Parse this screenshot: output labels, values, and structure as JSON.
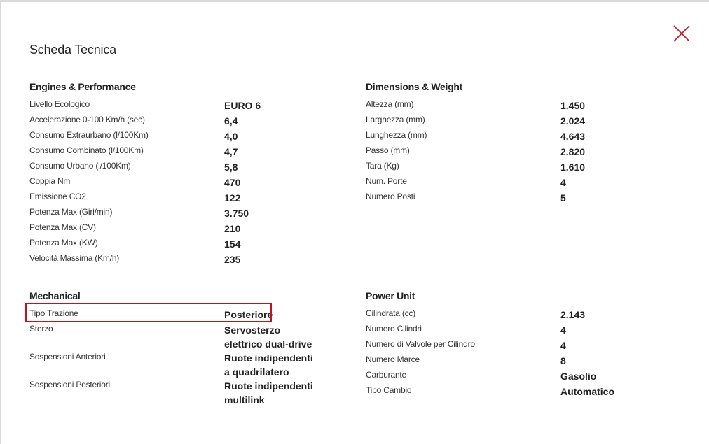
{
  "modal": {
    "title": "Scheda Tecnica",
    "close_icon": "close-icon",
    "accent_color": "#c1121f"
  },
  "sections": {
    "engines": {
      "heading": "Engines & Performance",
      "rows": [
        {
          "label": "Livello Ecologico",
          "value": "EURO 6"
        },
        {
          "label": "Accelerazione 0-100 Km/h (sec)",
          "value": "6,4"
        },
        {
          "label": "Consumo Extraurbano (l/100Km)",
          "value": "4,0"
        },
        {
          "label": "Consumo Combinato (l/100Km)",
          "value": "4,7"
        },
        {
          "label": "Consumo Urbano (l/100Km)",
          "value": "5,8"
        },
        {
          "label": "Coppia Nm",
          "value": "470"
        },
        {
          "label": "Emissione CO2",
          "value": "122"
        },
        {
          "label": "Potenza Max (Giri/min)",
          "value": "3.750"
        },
        {
          "label": "Potenza Max (CV)",
          "value": "210"
        },
        {
          "label": "Potenza Max (KW)",
          "value": "154"
        },
        {
          "label": "Velocità Massima (Km/h)",
          "value": "235"
        }
      ]
    },
    "dimensions": {
      "heading": "Dimensions & Weight",
      "rows": [
        {
          "label": "Altezza (mm)",
          "value": "1.450"
        },
        {
          "label": "Larghezza (mm)",
          "value": "2.024"
        },
        {
          "label": "Lunghezza (mm)",
          "value": "4.643"
        },
        {
          "label": "Passo (mm)",
          "value": "2.820"
        },
        {
          "label": "Tara (Kg)",
          "value": "1.610"
        },
        {
          "label": "Num. Porte",
          "value": "4"
        },
        {
          "label": "Numero Posti",
          "value": "5"
        }
      ]
    },
    "mechanical": {
      "heading": "Mechanical",
      "rows": [
        {
          "label": "Tipo Trazione",
          "value": "Posteriore"
        },
        {
          "label": "Sterzo",
          "value": "Servosterzo elettrico dual-drive"
        },
        {
          "label": "Sospensioni Anteriori",
          "value": "Ruote indipendenti a quadrilatero"
        },
        {
          "label": "Sospensioni Posteriori",
          "value": "Ruote indipendenti multilink"
        }
      ]
    },
    "power_unit": {
      "heading": "Power Unit",
      "rows": [
        {
          "label": "Cilindrata (cc)",
          "value": "2.143"
        },
        {
          "label": "Numero Cilindri",
          "value": "4"
        },
        {
          "label": "Numero di Valvole per Cilindro",
          "value": "4"
        },
        {
          "label": "Numero Marce",
          "value": "8"
        },
        {
          "label": "Carburante",
          "value": "Gasolio"
        },
        {
          "label": "Tipo Cambio",
          "value": "Automatico"
        }
      ]
    }
  }
}
